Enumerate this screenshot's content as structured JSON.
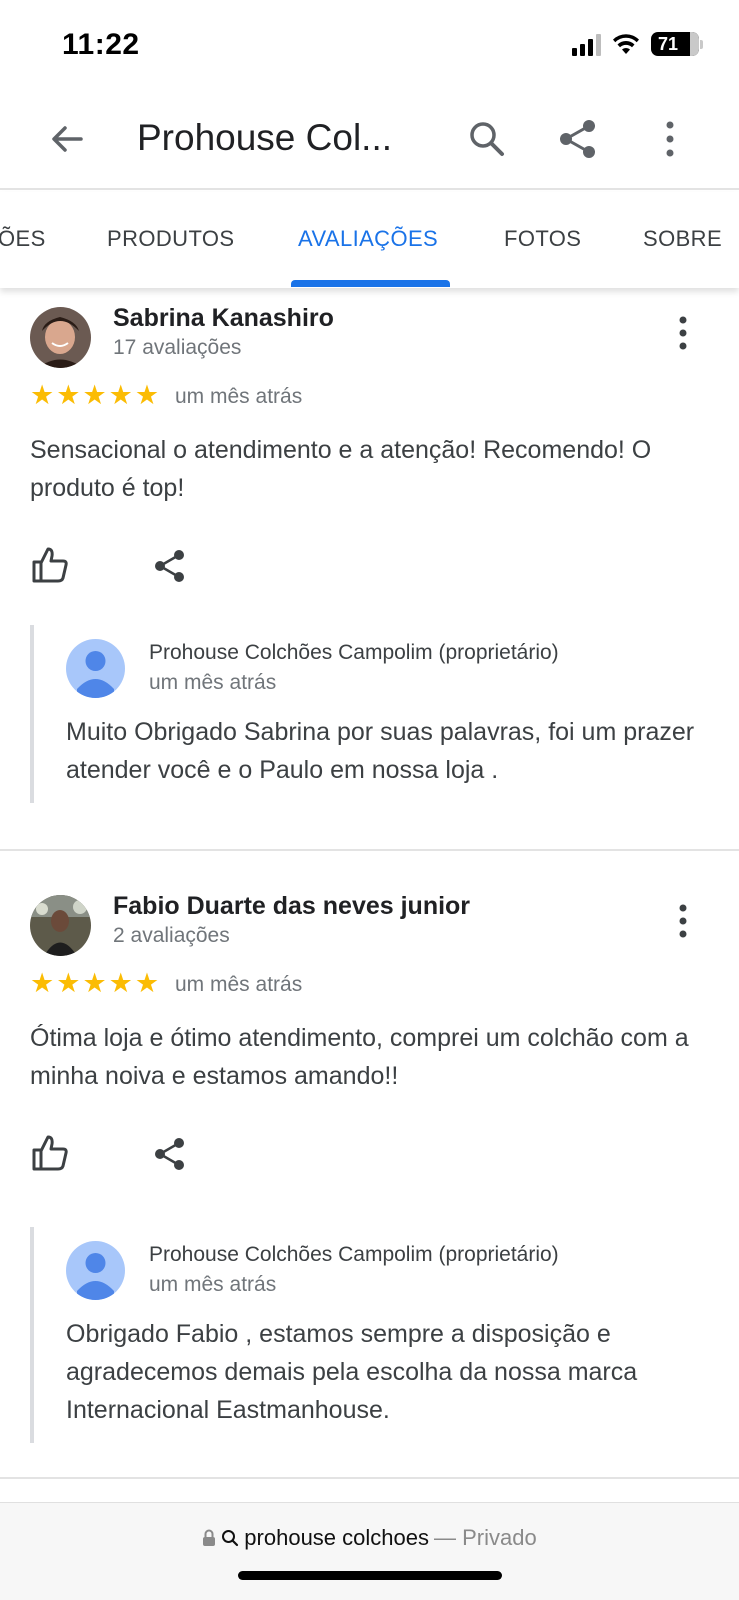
{
  "status_bar": {
    "time": "11:22",
    "battery": "71"
  },
  "app_bar": {
    "title": "Prohouse Col..."
  },
  "tabs": [
    {
      "label": "ÕES"
    },
    {
      "label": "PRODUTOS"
    },
    {
      "label": "AVALIAÇÕES",
      "active": true
    },
    {
      "label": "FOTOS"
    },
    {
      "label": "SOBRE"
    }
  ],
  "reviews": [
    {
      "reviewer": "Sabrina Kanashiro",
      "review_count": "17 avaliações",
      "rating": 5,
      "date": "um mês atrás",
      "text": "Sensacional o atendimento e a atenção! Recomendo! O produto é top!",
      "owner_reply": {
        "name": "Prohouse Colchões Campolim (proprietário)",
        "date": "um mês atrás",
        "text": "Muito Obrigado Sabrina por suas palavras, foi um prazer atender você e o Paulo em nossa loja ."
      }
    },
    {
      "reviewer": "Fabio Duarte das neves junior",
      "review_count": "2 avaliações",
      "rating": 5,
      "date": "um mês atrás",
      "text": "Ótima loja e ótimo atendimento, comprei um colchão com a minha noiva e estamos amando!!",
      "owner_reply": {
        "name": "Prohouse Colchões Campolim (proprietário)",
        "date": "um mês atrás",
        "text": "Obrigado Fabio , estamos sempre a disposição e agradecemos demais pela escolha da nossa marca Internacional Eastmanhouse."
      }
    }
  ],
  "browser_bar": {
    "url": "prohouse colchoes",
    "mode": "— Privado"
  },
  "colors": {
    "accent": "#1a73e8",
    "star": "#fbbc04"
  }
}
